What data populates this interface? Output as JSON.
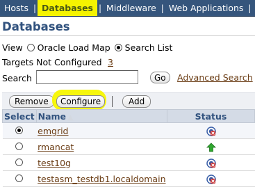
{
  "nav": {
    "tabs": [
      {
        "label": "Hosts"
      },
      {
        "label": "Databases",
        "selected": true
      },
      {
        "label": "Middleware"
      },
      {
        "label": "Web Applications"
      },
      {
        "label": "S"
      }
    ],
    "selected_tab_color": "#f5f300",
    "bar_color": "#35557c"
  },
  "page": {
    "title": "Databases",
    "title_color": "#31527e"
  },
  "view": {
    "label": "View",
    "option_map": "Oracle Load Map",
    "option_list": "Search List",
    "selected": "Search List"
  },
  "targets": {
    "label": "Targets Not Configured",
    "count": "3"
  },
  "search": {
    "label": "Search",
    "value": "",
    "go_label": "Go",
    "advanced_label": "Advanced Search"
  },
  "toolbar": {
    "remove_label": "Remove",
    "configure_label": "Configure",
    "add_label": "Add",
    "highlight_color": "#f7f700"
  },
  "table": {
    "headers": {
      "select": "Select",
      "name": "Name",
      "status": "Status"
    },
    "sort": "ascending by Name",
    "rows": [
      {
        "name": "emgrid",
        "selected": true,
        "status": "metric-collection-error-icon"
      },
      {
        "name": "rmancat",
        "selected": false,
        "status": "up-arrow-icon"
      },
      {
        "name": "test10g",
        "selected": false,
        "status": "metric-collection-error-icon"
      },
      {
        "name": "testasm_testdb1.localdomain",
        "selected": false,
        "status": "metric-collection-error-icon"
      }
    ]
  },
  "colors": {
    "link": "#6a3c14",
    "header_bg": "#d4dbe6",
    "status_up": "#2fa82f"
  }
}
